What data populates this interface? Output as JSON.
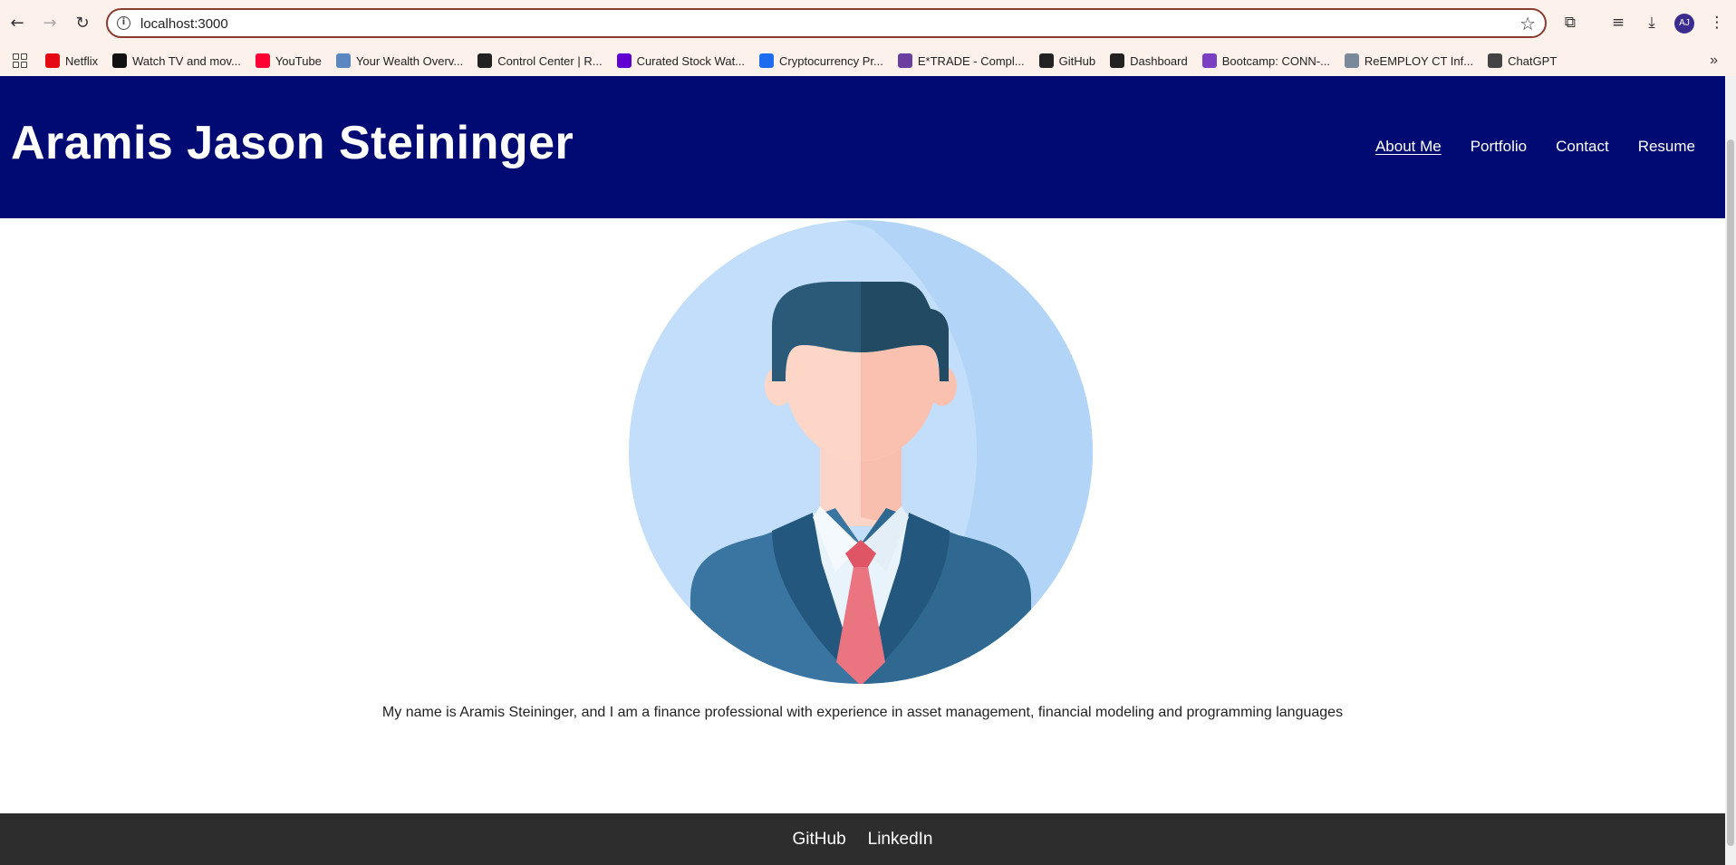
{
  "browser": {
    "url": "localhost:3000",
    "avatar_initials": "AJ",
    "bookmarks": [
      {
        "label": "Netflix",
        "icon": "netflix-icon",
        "color": "#e50914"
      },
      {
        "label": "Watch TV and mov...",
        "icon": "hulu-icon",
        "color": "#111111"
      },
      {
        "label": "YouTube",
        "icon": "youtube-icon",
        "color": "#ff0033"
      },
      {
        "label": "Your Wealth Overv...",
        "icon": "wealth-icon",
        "color": "#5b88c2"
      },
      {
        "label": "Control Center | R...",
        "icon": "rv-icon",
        "color": "#222222"
      },
      {
        "label": "Curated Stock Wat...",
        "icon": "yahoo-icon",
        "color": "#6001d2"
      },
      {
        "label": "Cryptocurrency Pr...",
        "icon": "crypto-icon",
        "color": "#1e6cf0"
      },
      {
        "label": "E*TRADE - Compl...",
        "icon": "etrade-icon",
        "color": "#6b3fa0"
      },
      {
        "label": "GitHub",
        "icon": "github-icon",
        "color": "#222222"
      },
      {
        "label": "Dashboard",
        "icon": "dashboard-icon",
        "color": "#222222"
      },
      {
        "label": "Bootcamp: CONN-...",
        "icon": "edx-icon",
        "color": "#7b3fc4"
      },
      {
        "label": "ReEMPLOY CT Inf...",
        "icon": "reemploy-icon",
        "color": "#7a8a9a"
      },
      {
        "label": "ChatGPT",
        "icon": "chatgpt-icon",
        "color": "#444444"
      }
    ]
  },
  "site": {
    "title": "Aramis Jason Steininger",
    "nav": [
      {
        "label": "About Me",
        "active": true
      },
      {
        "label": "Portfolio",
        "active": false
      },
      {
        "label": "Contact",
        "active": false
      },
      {
        "label": "Resume",
        "active": false
      }
    ],
    "bio": "My name is Aramis Steininger, and I am a finance professional with experience in asset management, financial modeling and programming languages",
    "footer_links": [
      "GitHub",
      "LinkedIn"
    ]
  },
  "colors": {
    "header_bg": "#000a73",
    "footer_bg": "#2d2d2d",
    "chrome_bg": "#fdf1ec"
  }
}
